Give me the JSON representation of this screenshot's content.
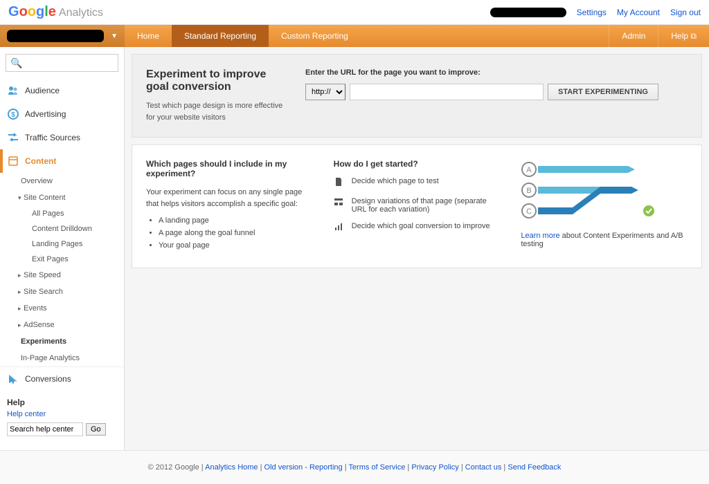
{
  "header": {
    "product": "Analytics",
    "links": {
      "settings": "Settings",
      "account": "My Account",
      "signout": "Sign out"
    }
  },
  "navbar": {
    "home": "Home",
    "standard": "Standard Reporting",
    "custom": "Custom Reporting",
    "admin": "Admin",
    "help": "Help"
  },
  "sidebar": {
    "search_placeholder": "",
    "items": {
      "audience": "Audience",
      "advertising": "Advertising",
      "traffic": "Traffic Sources",
      "content": "Content",
      "conversions": "Conversions"
    },
    "content_sub": {
      "overview": "Overview",
      "site_content": "Site Content",
      "all_pages": "All Pages",
      "content_drilldown": "Content Drilldown",
      "landing_pages": "Landing Pages",
      "exit_pages": "Exit Pages",
      "site_speed": "Site Speed",
      "site_search": "Site Search",
      "events": "Events",
      "adsense": "AdSense",
      "experiments": "Experiments",
      "inpage": "In-Page Analytics"
    },
    "help": {
      "title": "Help",
      "center": "Help center",
      "search_value": "Search help center",
      "go": "Go"
    }
  },
  "main": {
    "title": "Experiment to improve goal conversion",
    "subtitle": "Test which page design is more effective for your website visitors",
    "url_label": "Enter the URL for the page you want to improve:",
    "proto": "http://",
    "start_btn": "START EXPERIMENTING",
    "col1": {
      "heading": "Which pages should I include in my experiment?",
      "intro": "Your experiment can focus on any single page that helps visitors accomplish a specific goal:",
      "b1": "A landing page",
      "b2": "A page along the goal funnel",
      "b3": "Your goal page"
    },
    "col2": {
      "heading": "How do I get started?",
      "s1": "Decide which page to test",
      "s2": "Design variations of that page (separate URL for each variation)",
      "s3": "Decide which goal conversion to improve"
    },
    "col3": {
      "learn_more": "Learn more",
      "rest": " about Content Experiments and A/B testing"
    }
  },
  "footer": {
    "copyright": "© 2012 Google",
    "links": {
      "analytics_home": "Analytics Home",
      "old_version": "Old version - Reporting",
      "tos": "Terms of Service",
      "privacy": "Privacy Policy",
      "contact": "Contact us",
      "feedback": "Send Feedback"
    }
  }
}
